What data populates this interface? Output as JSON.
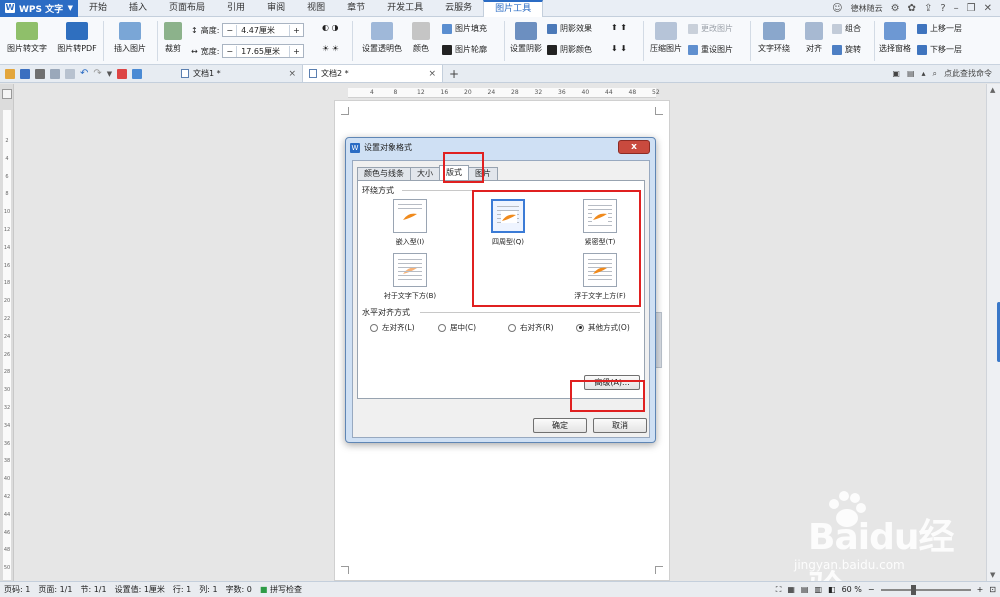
{
  "app": {
    "name": "WPS 文字",
    "logo_letter": "W"
  },
  "menu": {
    "tabs": [
      "开始",
      "插入",
      "页面布局",
      "引用",
      "审阅",
      "视图",
      "章节",
      "开发工具",
      "云服务",
      "图片工具"
    ],
    "active_tab": "图片工具",
    "user": "德林随云",
    "help": "?"
  },
  "ribbon": {
    "pic_to_text": "图片转文字",
    "pic_to_pdf": "图片转PDF",
    "insert_pic": "插入图片",
    "crop": "裁剪",
    "height_label": "高度:",
    "height_value": "4.47厘米",
    "width_label": "宽度:",
    "width_value": "17.65厘米",
    "set_transparent": "设置透明色",
    "color": "颜色",
    "pic_fill": "图片填充",
    "pic_outline": "图片轮廓",
    "set_shadow": "设置阴影",
    "shadow_effect": "阴影效果",
    "shadow_color": "阴影颜色",
    "compress": "压缩图片",
    "change_pic": "更改图片",
    "reset_pic": "重设图片",
    "text_wrap": "文字环绕",
    "align": "对齐",
    "group": "组合",
    "rotate": "旋转",
    "selection_pane": "选择窗格",
    "bring_forward": "上移一层",
    "send_backward": "下移一层",
    "minus": "−",
    "plus": "+"
  },
  "docbar": {
    "tab1": "文档1 *",
    "tab2": "文档2 *",
    "close": "×",
    "add": "+",
    "search": "点此查找命令"
  },
  "hruler": [
    "4",
    "8",
    "12",
    "16",
    "20",
    "24",
    "28",
    "32",
    "36",
    "40",
    "44",
    "48",
    "52"
  ],
  "vruler": [
    "2",
    "4",
    "6",
    "8",
    "10",
    "12",
    "14",
    "16",
    "18",
    "20",
    "22",
    "24",
    "26",
    "28",
    "30",
    "32",
    "34",
    "36",
    "38",
    "40",
    "42",
    "44",
    "46",
    "48",
    "50"
  ],
  "dialog": {
    "title": "设置对象格式",
    "close": "x",
    "tabs": [
      "颜色与线条",
      "大小",
      "版式",
      "图片"
    ],
    "active_tab": "版式",
    "wrap_group": "环绕方式",
    "wrap_options": {
      "inline": "嵌入型(I)",
      "square": "四周型(Q)",
      "tight": "紧密型(T)",
      "behind": "衬于文字下方(B)",
      "front": "浮于文字上方(F)"
    },
    "selected_wrap": "四周型(Q)",
    "halign_group": "水平对齐方式",
    "halign_options": [
      "左对齐(L)",
      "居中(C)",
      "右对齐(R)",
      "其他方式(O)"
    ],
    "selected_halign": "其他方式(O)",
    "advanced": "高级(A)...",
    "ok": "确定",
    "cancel": "取消"
  },
  "status": {
    "page_no": "页码: 1",
    "pages": "页面: 1/1",
    "section": "节: 1/1",
    "setting": "设置值: 1厘米",
    "row": "行: 1",
    "col": "列: 1",
    "chars": "字数: 0",
    "spell": "拼写检查",
    "zoom": "60 %"
  },
  "watermark": {
    "brand": "Baidu经验",
    "url": "jingyan.baidu.com"
  },
  "colors": {
    "accent": "#2b6cc4",
    "highlight": "#e02020",
    "dialog_frame": "#cfe0f4"
  }
}
